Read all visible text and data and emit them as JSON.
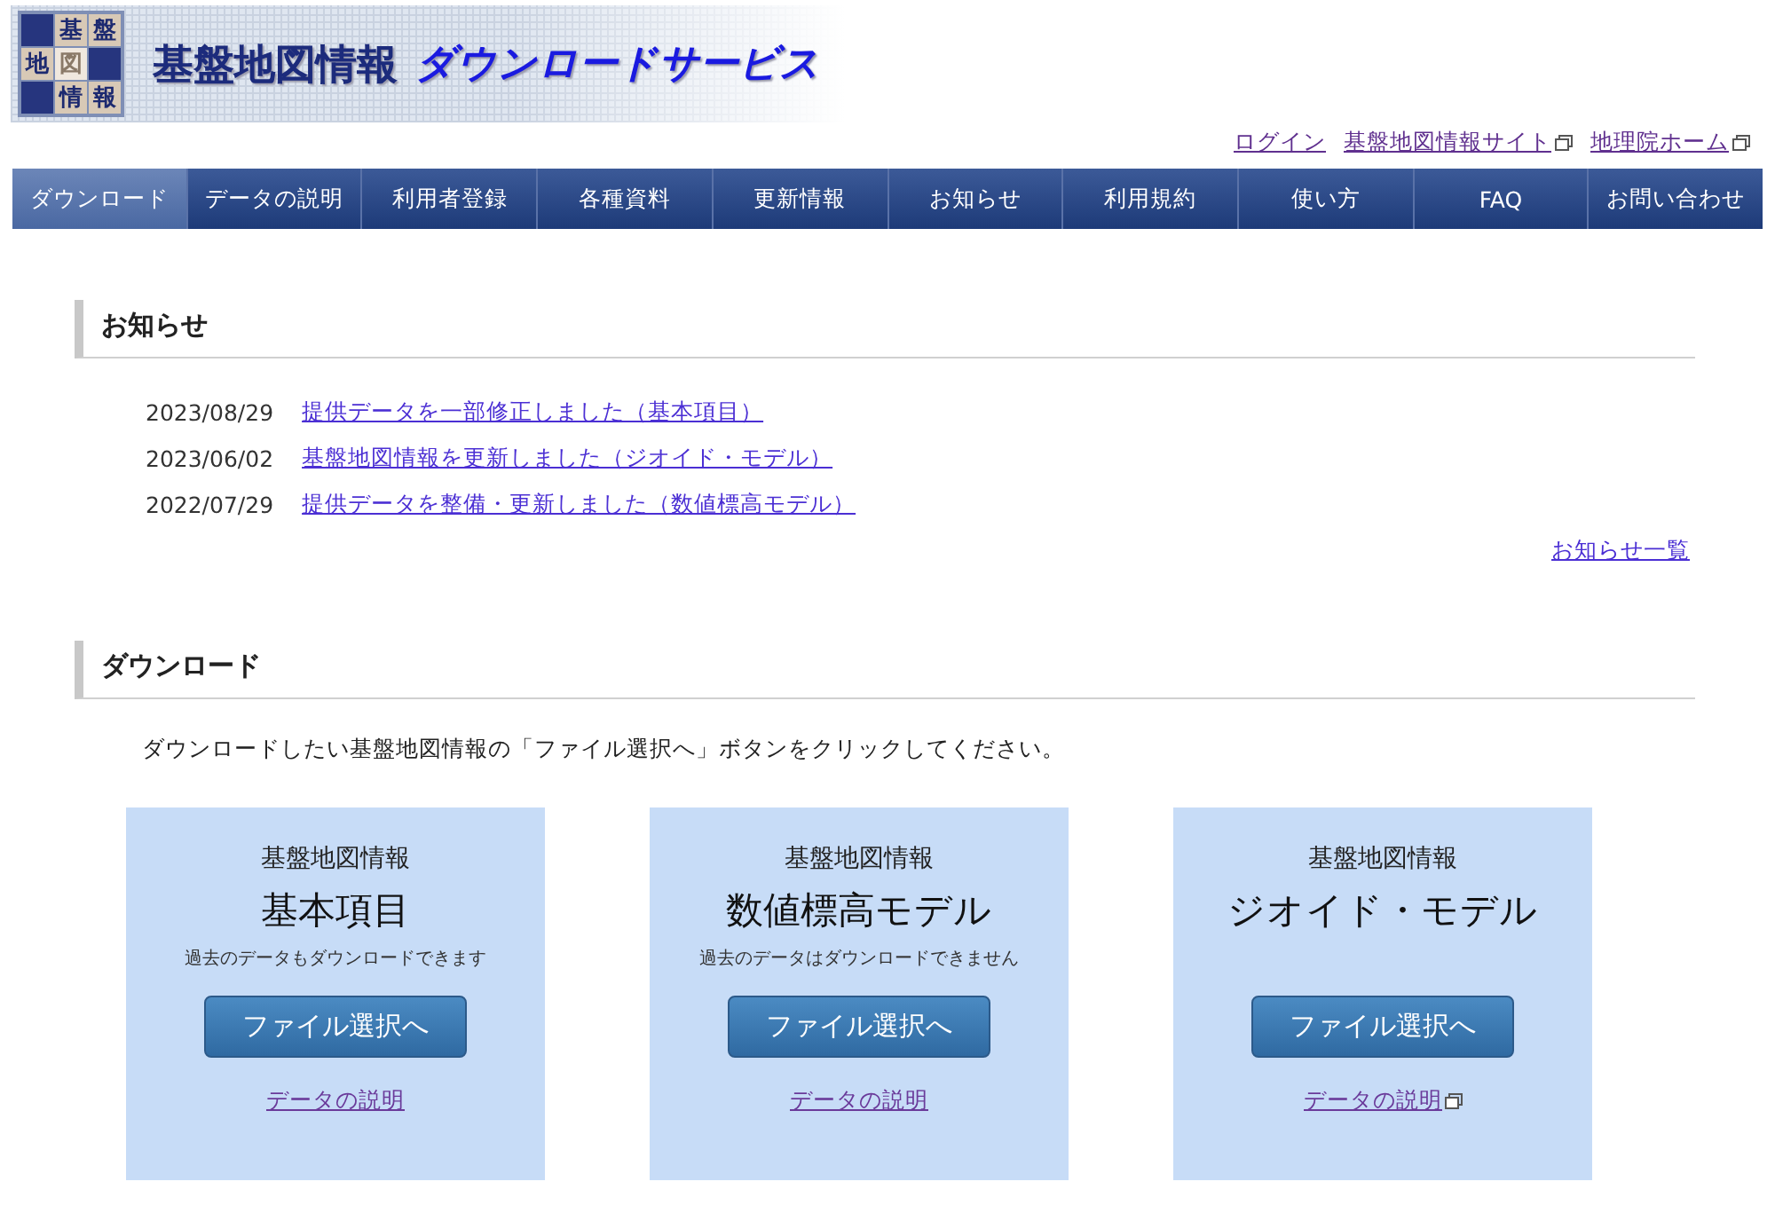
{
  "header": {
    "logo_chars": [
      "基",
      "盤",
      "地",
      "図",
      "情",
      "報"
    ],
    "title": "基盤地図情報",
    "subtitle": "ダウンロードサービス"
  },
  "top_links": [
    {
      "label": "ログイン",
      "external": false
    },
    {
      "label": "基盤地図情報サイト",
      "external": true
    },
    {
      "label": "地理院ホーム",
      "external": true
    }
  ],
  "nav": [
    {
      "label": "ダウンロード",
      "selected": true
    },
    {
      "label": "データの説明",
      "selected": false
    },
    {
      "label": "利用者登録",
      "selected": false
    },
    {
      "label": "各種資料",
      "selected": false
    },
    {
      "label": "更新情報",
      "selected": false
    },
    {
      "label": "お知らせ",
      "selected": false
    },
    {
      "label": "利用規約",
      "selected": false
    },
    {
      "label": "使い方",
      "selected": false
    },
    {
      "label": "FAQ",
      "selected": false
    },
    {
      "label": "お問い合わせ",
      "selected": false
    }
  ],
  "news": {
    "heading": "お知らせ",
    "items": [
      {
        "date": "2023/08/29",
        "text": "提供データを一部修正しました（基本項目）"
      },
      {
        "date": "2023/06/02",
        "text": "基盤地図情報を更新しました（ジオイド・モデル）"
      },
      {
        "date": "2022/07/29",
        "text": "提供データを整備・更新しました（数値標高モデル）"
      }
    ],
    "more": "お知らせ一覧"
  },
  "download": {
    "heading": "ダウンロード",
    "intro": "ダウンロードしたい基盤地図情報の「ファイル選択へ」ボタンをクリックしてください。",
    "cards": [
      {
        "label": "基盤地図情報",
        "title": "基本項目",
        "note": "過去のデータもダウンロードできます",
        "button": "ファイル選択へ",
        "link": "データの説明",
        "external": false
      },
      {
        "label": "基盤地図情報",
        "title": "数値標高モデル",
        "note": "過去のデータはダウンロードできません",
        "button": "ファイル選択へ",
        "link": "データの説明",
        "external": false
      },
      {
        "label": "基盤地図情報",
        "title": "ジオイド・モデル",
        "button": "ファイル選択へ",
        "link": "データの説明",
        "external": true
      }
    ]
  }
}
